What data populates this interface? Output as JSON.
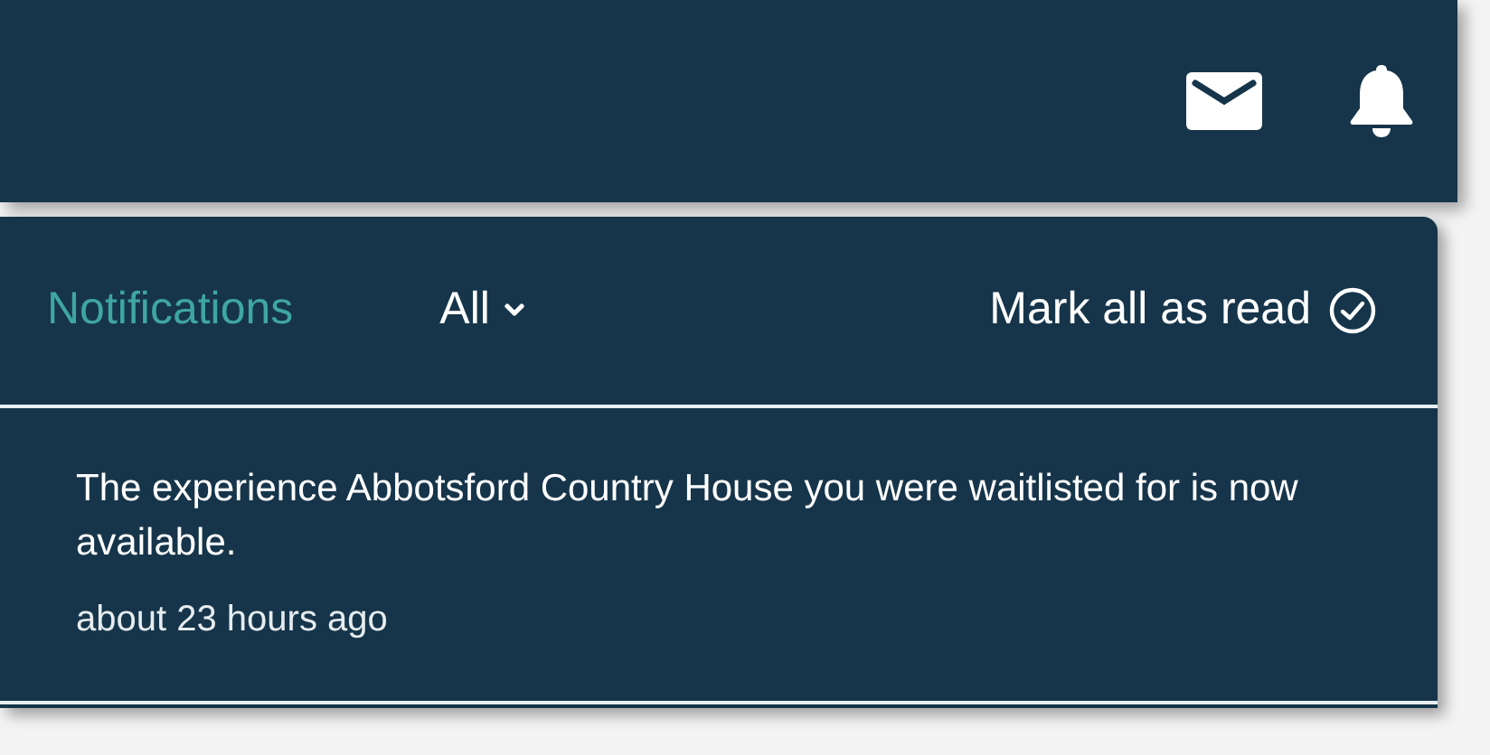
{
  "header": {
    "title": "Notifications",
    "filter": {
      "label": "All"
    },
    "mark_all": {
      "label": "Mark all as read"
    }
  },
  "notifications": [
    {
      "message": "The experience Abbotsford Country House you were waitlisted for is now available.",
      "time": "about 23 hours ago"
    }
  ]
}
